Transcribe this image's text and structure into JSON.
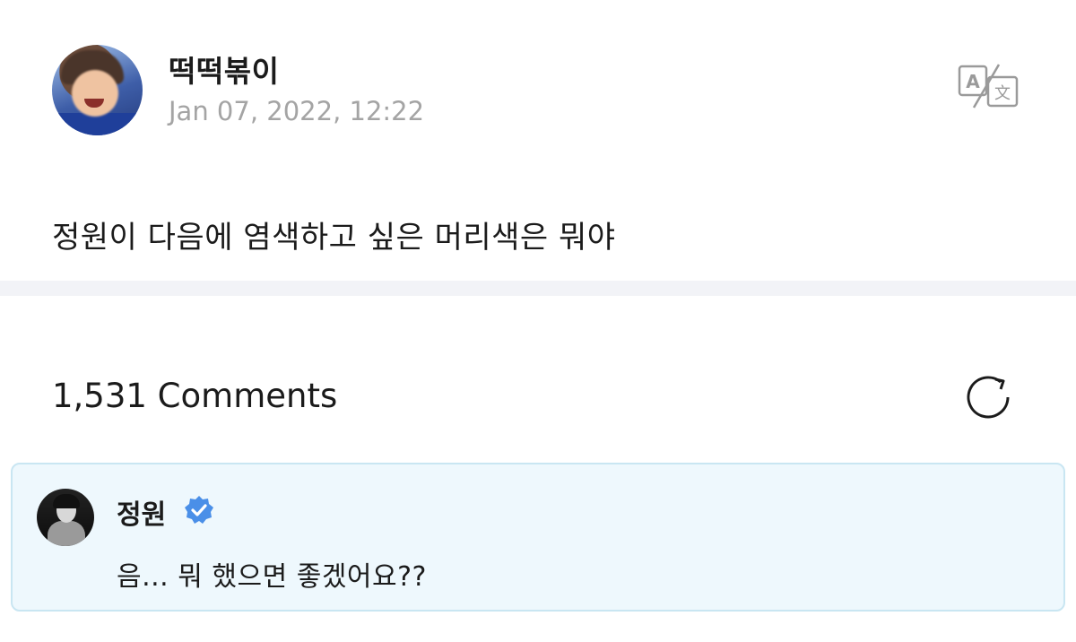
{
  "post": {
    "author": "떡떡볶이",
    "timestamp": "Jan 07, 2022, 12:22",
    "body": "정원이 다음에 염색하고 싶은 머리색은 뭐야",
    "translate_icon": "translate-icon"
  },
  "comments": {
    "count_label": "1,531 Comments",
    "refresh_icon": "refresh-icon",
    "featured": {
      "author": "정원",
      "verified_icon": "verified-badge-icon",
      "text": "음... 뭐 했으면 좋겠어요??"
    }
  },
  "colors": {
    "timestamp": "#a4a4a4",
    "divider": "#f2f3f7",
    "comment_background": "#eef8fd",
    "comment_border": "#c9e6f2",
    "verified_badge": "#4a8fe8"
  }
}
